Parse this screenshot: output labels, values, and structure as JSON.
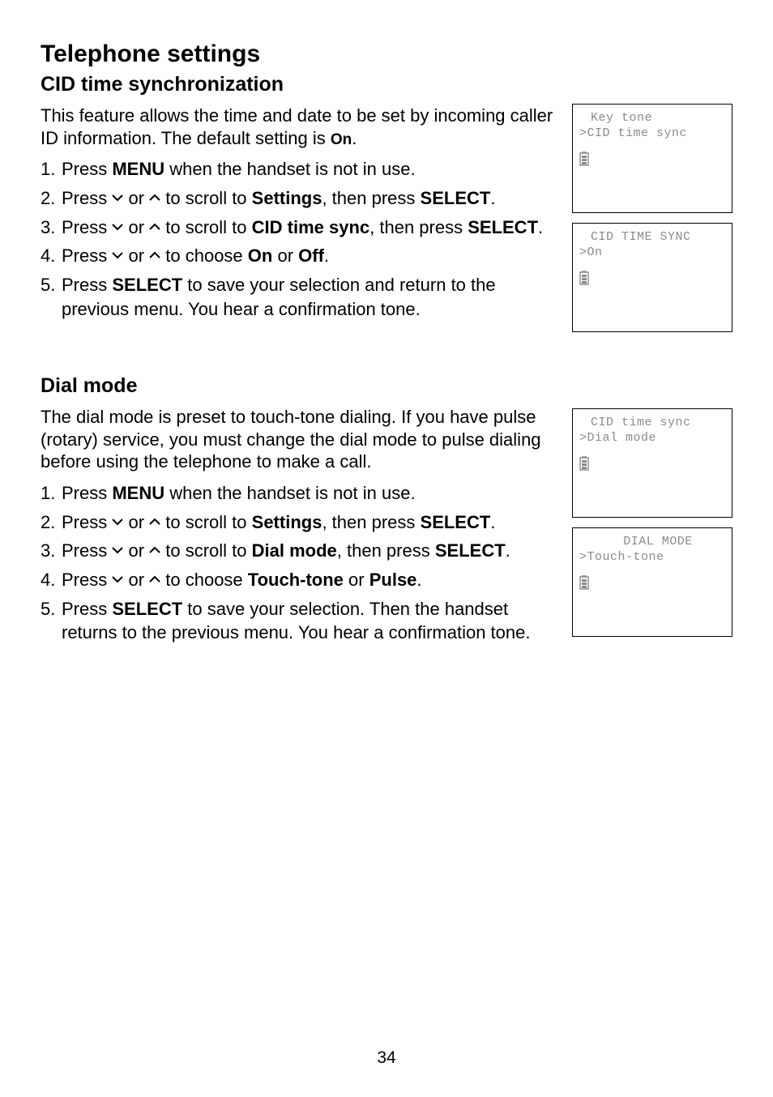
{
  "page_number": "34",
  "headings": {
    "h1": "Telephone settings",
    "h2a": "CID time synchronization",
    "h2b": "Dial mode"
  },
  "intro": {
    "cid_p1": "This feature allows the time and date to be set by incoming caller ID information. The default setting is ",
    "cid_default": "On",
    "cid_p2": ".",
    "dial": "The dial mode is preset to touch-tone dialing. If you have pulse (rotary) service, you must change the dial mode to pulse dialing before using the telephone to make a call."
  },
  "words": {
    "press": "Press ",
    "menu": "MENU",
    "select": "SELECT",
    "settings": "Settings",
    "cid_time_sync": "CID time sync",
    "dial_mode": "Dial mode",
    "on": "On",
    "off": "Off",
    "touch_tone": "Touch-tone",
    "pulse": "Pulse",
    "or": " or ",
    "when_not_in_use": " when the handset is not in use.",
    "to_scroll_to": " to scroll to ",
    "then_press": ", then press ",
    "to_choose": " to choose ",
    "period": ".",
    "save_return_prev": " to save your selection and return to the previous menu. You hear a confirmation tone.",
    "save_then_handset": " to save your selection. Then the handset returns to the previous menu. You hear a confirmation tone."
  },
  "lcd": {
    "s1_l1": "Key tone",
    "s1_l2": ">CID time sync",
    "s2_l1": "CID TIME SYNC",
    "s2_l2": ">On",
    "s3_l1": "CID time sync",
    "s3_l2": ">Dial mode",
    "s4_l1": "DIAL MODE",
    "s4_l2": ">Touch-tone"
  }
}
